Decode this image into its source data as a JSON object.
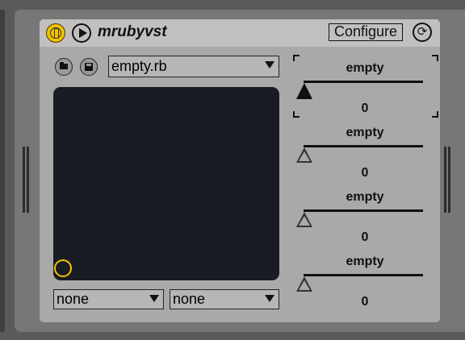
{
  "header": {
    "title": "mrubyvst",
    "configure_label": "Configure"
  },
  "script_select": {
    "value": "empty.rb"
  },
  "bottom_selects": [
    {
      "value": "none"
    },
    {
      "value": "none"
    }
  ],
  "params": [
    {
      "label": "empty",
      "value": "0"
    },
    {
      "label": "empty",
      "value": "0"
    },
    {
      "label": "empty",
      "value": "0"
    },
    {
      "label": "empty",
      "value": "0"
    }
  ],
  "icons": {
    "power": "power-icon",
    "play": "play-icon",
    "refresh": "refresh-icon",
    "open": "folder-icon",
    "save": "save-icon"
  },
  "colors": {
    "accent": "#f0c000",
    "pad": "#191c22",
    "device": "#a9a9a9"
  }
}
